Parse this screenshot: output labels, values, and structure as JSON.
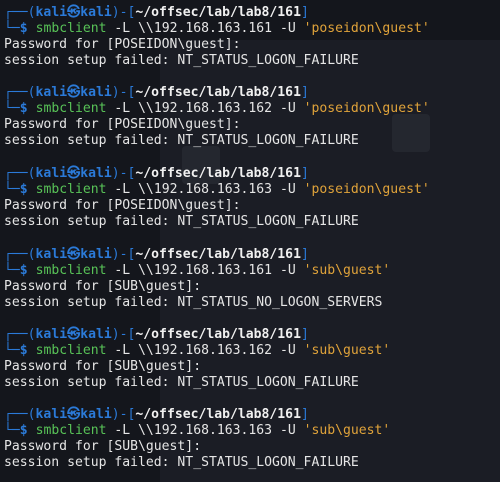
{
  "prompt": {
    "corner_top": "┌──",
    "corner_bottom": "└─",
    "open_paren": "(",
    "close_paren": ")",
    "user": "kali",
    "at": "㉿",
    "host": "kali",
    "dash": "-",
    "open_bracket": "[",
    "close_bracket": "]",
    "path": "~/offsec/lab/lab8/161",
    "dollar": "$"
  },
  "blocks": [
    {
      "cmd": "smbclient",
      "flags": " -L \\\\192.168.163.161 -U ",
      "quoted": "'poseidon\\guest'",
      "out1": "Password for [POSEIDON\\guest]:",
      "out2": "session setup failed: NT_STATUS_LOGON_FAILURE"
    },
    {
      "cmd": "smbclient",
      "flags": " -L \\\\192.168.163.162 -U ",
      "quoted": "'poseidon\\guest'",
      "out1": "Password for [POSEIDON\\guest]:",
      "out2": "session setup failed: NT_STATUS_LOGON_FAILURE"
    },
    {
      "cmd": "smbclient",
      "flags": " -L \\\\192.168.163.163 -U ",
      "quoted": "'poseidon\\guest'",
      "out1": "Password for [POSEIDON\\guest]:",
      "out2": "session setup failed: NT_STATUS_LOGON_FAILURE"
    },
    {
      "cmd": "smbclient",
      "flags": " -L \\\\192.168.163.161 -U ",
      "quoted": "'sub\\guest'",
      "out1": "Password for [SUB\\guest]:",
      "out2": "session setup failed: NT_STATUS_NO_LOGON_SERVERS"
    },
    {
      "cmd": "smbclient",
      "flags": " -L \\\\192.168.163.162 -U ",
      "quoted": "'sub\\guest'",
      "out1": "Password for [SUB\\guest]:",
      "out2": "session setup failed: NT_STATUS_LOGON_FAILURE"
    },
    {
      "cmd": "smbclient",
      "flags": " -L \\\\192.168.163.163 -U ",
      "quoted": "'sub\\guest'",
      "out1": "Password for [SUB\\guest]:",
      "out2": "session setup failed: NT_STATUS_LOGON_FAILURE"
    }
  ],
  "colors": {
    "background": "#14161c",
    "prompt_blue": "#2b7ad8",
    "command_green": "#58c257",
    "quoted_orange": "#e0a33a",
    "text": "#e6e6e6"
  }
}
